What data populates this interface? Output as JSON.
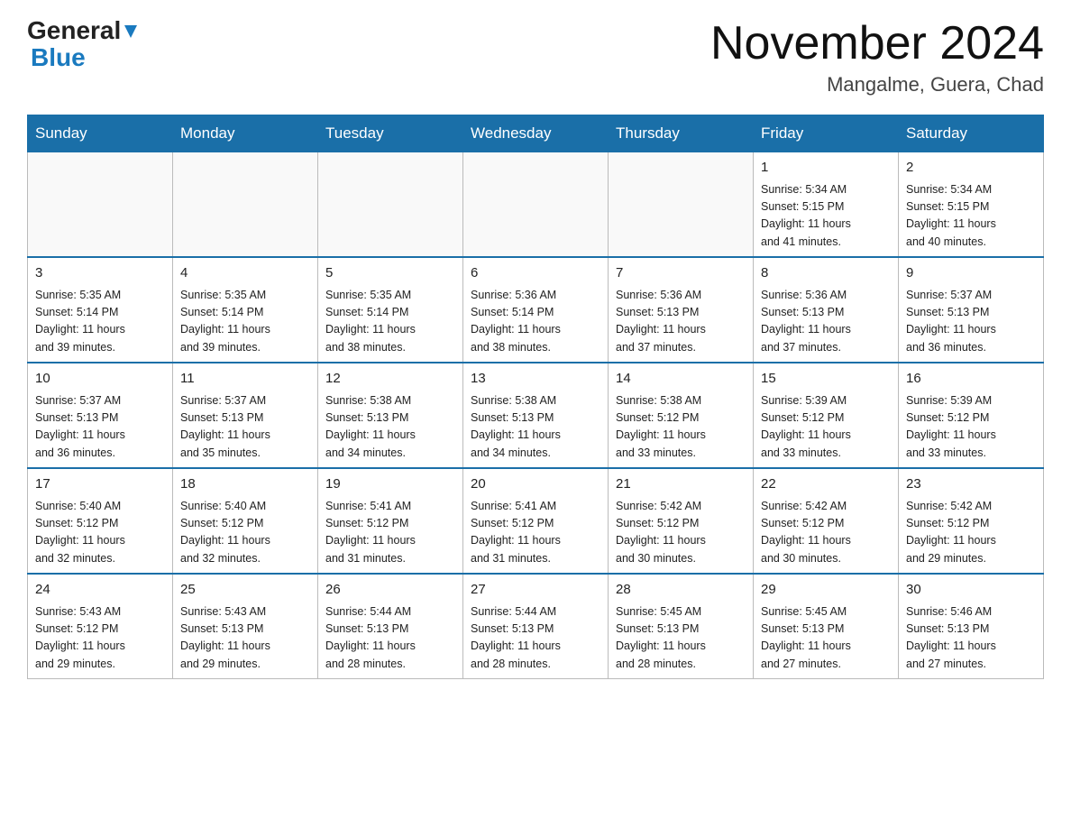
{
  "logo": {
    "part1": "General",
    "part2": "Blue"
  },
  "header": {
    "month": "November 2024",
    "location": "Mangalme, Guera, Chad"
  },
  "days_of_week": [
    "Sunday",
    "Monday",
    "Tuesday",
    "Wednesday",
    "Thursday",
    "Friday",
    "Saturday"
  ],
  "weeks": [
    [
      {
        "day": "",
        "info": ""
      },
      {
        "day": "",
        "info": ""
      },
      {
        "day": "",
        "info": ""
      },
      {
        "day": "",
        "info": ""
      },
      {
        "day": "",
        "info": ""
      },
      {
        "day": "1",
        "info": "Sunrise: 5:34 AM\nSunset: 5:15 PM\nDaylight: 11 hours\nand 41 minutes."
      },
      {
        "day": "2",
        "info": "Sunrise: 5:34 AM\nSunset: 5:15 PM\nDaylight: 11 hours\nand 40 minutes."
      }
    ],
    [
      {
        "day": "3",
        "info": "Sunrise: 5:35 AM\nSunset: 5:14 PM\nDaylight: 11 hours\nand 39 minutes."
      },
      {
        "day": "4",
        "info": "Sunrise: 5:35 AM\nSunset: 5:14 PM\nDaylight: 11 hours\nand 39 minutes."
      },
      {
        "day": "5",
        "info": "Sunrise: 5:35 AM\nSunset: 5:14 PM\nDaylight: 11 hours\nand 38 minutes."
      },
      {
        "day": "6",
        "info": "Sunrise: 5:36 AM\nSunset: 5:14 PM\nDaylight: 11 hours\nand 38 minutes."
      },
      {
        "day": "7",
        "info": "Sunrise: 5:36 AM\nSunset: 5:13 PM\nDaylight: 11 hours\nand 37 minutes."
      },
      {
        "day": "8",
        "info": "Sunrise: 5:36 AM\nSunset: 5:13 PM\nDaylight: 11 hours\nand 37 minutes."
      },
      {
        "day": "9",
        "info": "Sunrise: 5:37 AM\nSunset: 5:13 PM\nDaylight: 11 hours\nand 36 minutes."
      }
    ],
    [
      {
        "day": "10",
        "info": "Sunrise: 5:37 AM\nSunset: 5:13 PM\nDaylight: 11 hours\nand 36 minutes."
      },
      {
        "day": "11",
        "info": "Sunrise: 5:37 AM\nSunset: 5:13 PM\nDaylight: 11 hours\nand 35 minutes."
      },
      {
        "day": "12",
        "info": "Sunrise: 5:38 AM\nSunset: 5:13 PM\nDaylight: 11 hours\nand 34 minutes."
      },
      {
        "day": "13",
        "info": "Sunrise: 5:38 AM\nSunset: 5:13 PM\nDaylight: 11 hours\nand 34 minutes."
      },
      {
        "day": "14",
        "info": "Sunrise: 5:38 AM\nSunset: 5:12 PM\nDaylight: 11 hours\nand 33 minutes."
      },
      {
        "day": "15",
        "info": "Sunrise: 5:39 AM\nSunset: 5:12 PM\nDaylight: 11 hours\nand 33 minutes."
      },
      {
        "day": "16",
        "info": "Sunrise: 5:39 AM\nSunset: 5:12 PM\nDaylight: 11 hours\nand 33 minutes."
      }
    ],
    [
      {
        "day": "17",
        "info": "Sunrise: 5:40 AM\nSunset: 5:12 PM\nDaylight: 11 hours\nand 32 minutes."
      },
      {
        "day": "18",
        "info": "Sunrise: 5:40 AM\nSunset: 5:12 PM\nDaylight: 11 hours\nand 32 minutes."
      },
      {
        "day": "19",
        "info": "Sunrise: 5:41 AM\nSunset: 5:12 PM\nDaylight: 11 hours\nand 31 minutes."
      },
      {
        "day": "20",
        "info": "Sunrise: 5:41 AM\nSunset: 5:12 PM\nDaylight: 11 hours\nand 31 minutes."
      },
      {
        "day": "21",
        "info": "Sunrise: 5:42 AM\nSunset: 5:12 PM\nDaylight: 11 hours\nand 30 minutes."
      },
      {
        "day": "22",
        "info": "Sunrise: 5:42 AM\nSunset: 5:12 PM\nDaylight: 11 hours\nand 30 minutes."
      },
      {
        "day": "23",
        "info": "Sunrise: 5:42 AM\nSunset: 5:12 PM\nDaylight: 11 hours\nand 29 minutes."
      }
    ],
    [
      {
        "day": "24",
        "info": "Sunrise: 5:43 AM\nSunset: 5:12 PM\nDaylight: 11 hours\nand 29 minutes."
      },
      {
        "day": "25",
        "info": "Sunrise: 5:43 AM\nSunset: 5:13 PM\nDaylight: 11 hours\nand 29 minutes."
      },
      {
        "day": "26",
        "info": "Sunrise: 5:44 AM\nSunset: 5:13 PM\nDaylight: 11 hours\nand 28 minutes."
      },
      {
        "day": "27",
        "info": "Sunrise: 5:44 AM\nSunset: 5:13 PM\nDaylight: 11 hours\nand 28 minutes."
      },
      {
        "day": "28",
        "info": "Sunrise: 5:45 AM\nSunset: 5:13 PM\nDaylight: 11 hours\nand 28 minutes."
      },
      {
        "day": "29",
        "info": "Sunrise: 5:45 AM\nSunset: 5:13 PM\nDaylight: 11 hours\nand 27 minutes."
      },
      {
        "day": "30",
        "info": "Sunrise: 5:46 AM\nSunset: 5:13 PM\nDaylight: 11 hours\nand 27 minutes."
      }
    ]
  ]
}
